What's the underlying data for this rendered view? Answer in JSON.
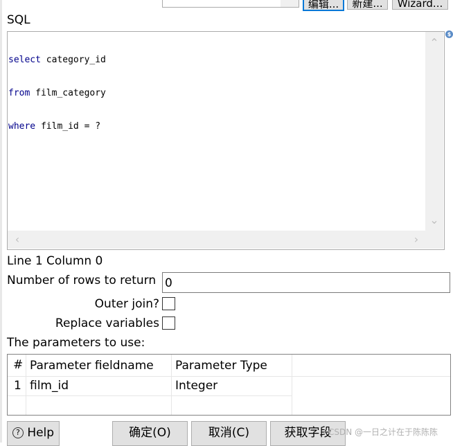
{
  "top": {
    "buttons": [
      "编辑...",
      "新建...",
      "Wizard..."
    ]
  },
  "sql": {
    "label": "SQL",
    "lines": [
      {
        "kw": "select",
        "rest": " category_id"
      },
      {
        "kw": "from",
        "rest": " film_category"
      },
      {
        "kw": "where",
        "rest": " film_id = ?"
      }
    ],
    "icon": "dollar-icon"
  },
  "status": {
    "position": "Line 1 Column 0"
  },
  "form": {
    "rows_label": "Number of rows to return",
    "rows_value": "0",
    "outer_join_label": "Outer join?",
    "replace_vars_label": "Replace variables"
  },
  "params": {
    "label": "The parameters to use:",
    "columns": [
      "#",
      "Parameter fieldname",
      "Parameter Type"
    ],
    "rows": [
      {
        "num": "1",
        "fieldname": "film_id",
        "type": "Integer"
      }
    ]
  },
  "buttons": {
    "help": "Help",
    "ok": "确定(O)",
    "cancel": "取消(C)",
    "get_fields": "获取字段"
  },
  "watermark": "CSDN @一日之计在于陈陈陈"
}
